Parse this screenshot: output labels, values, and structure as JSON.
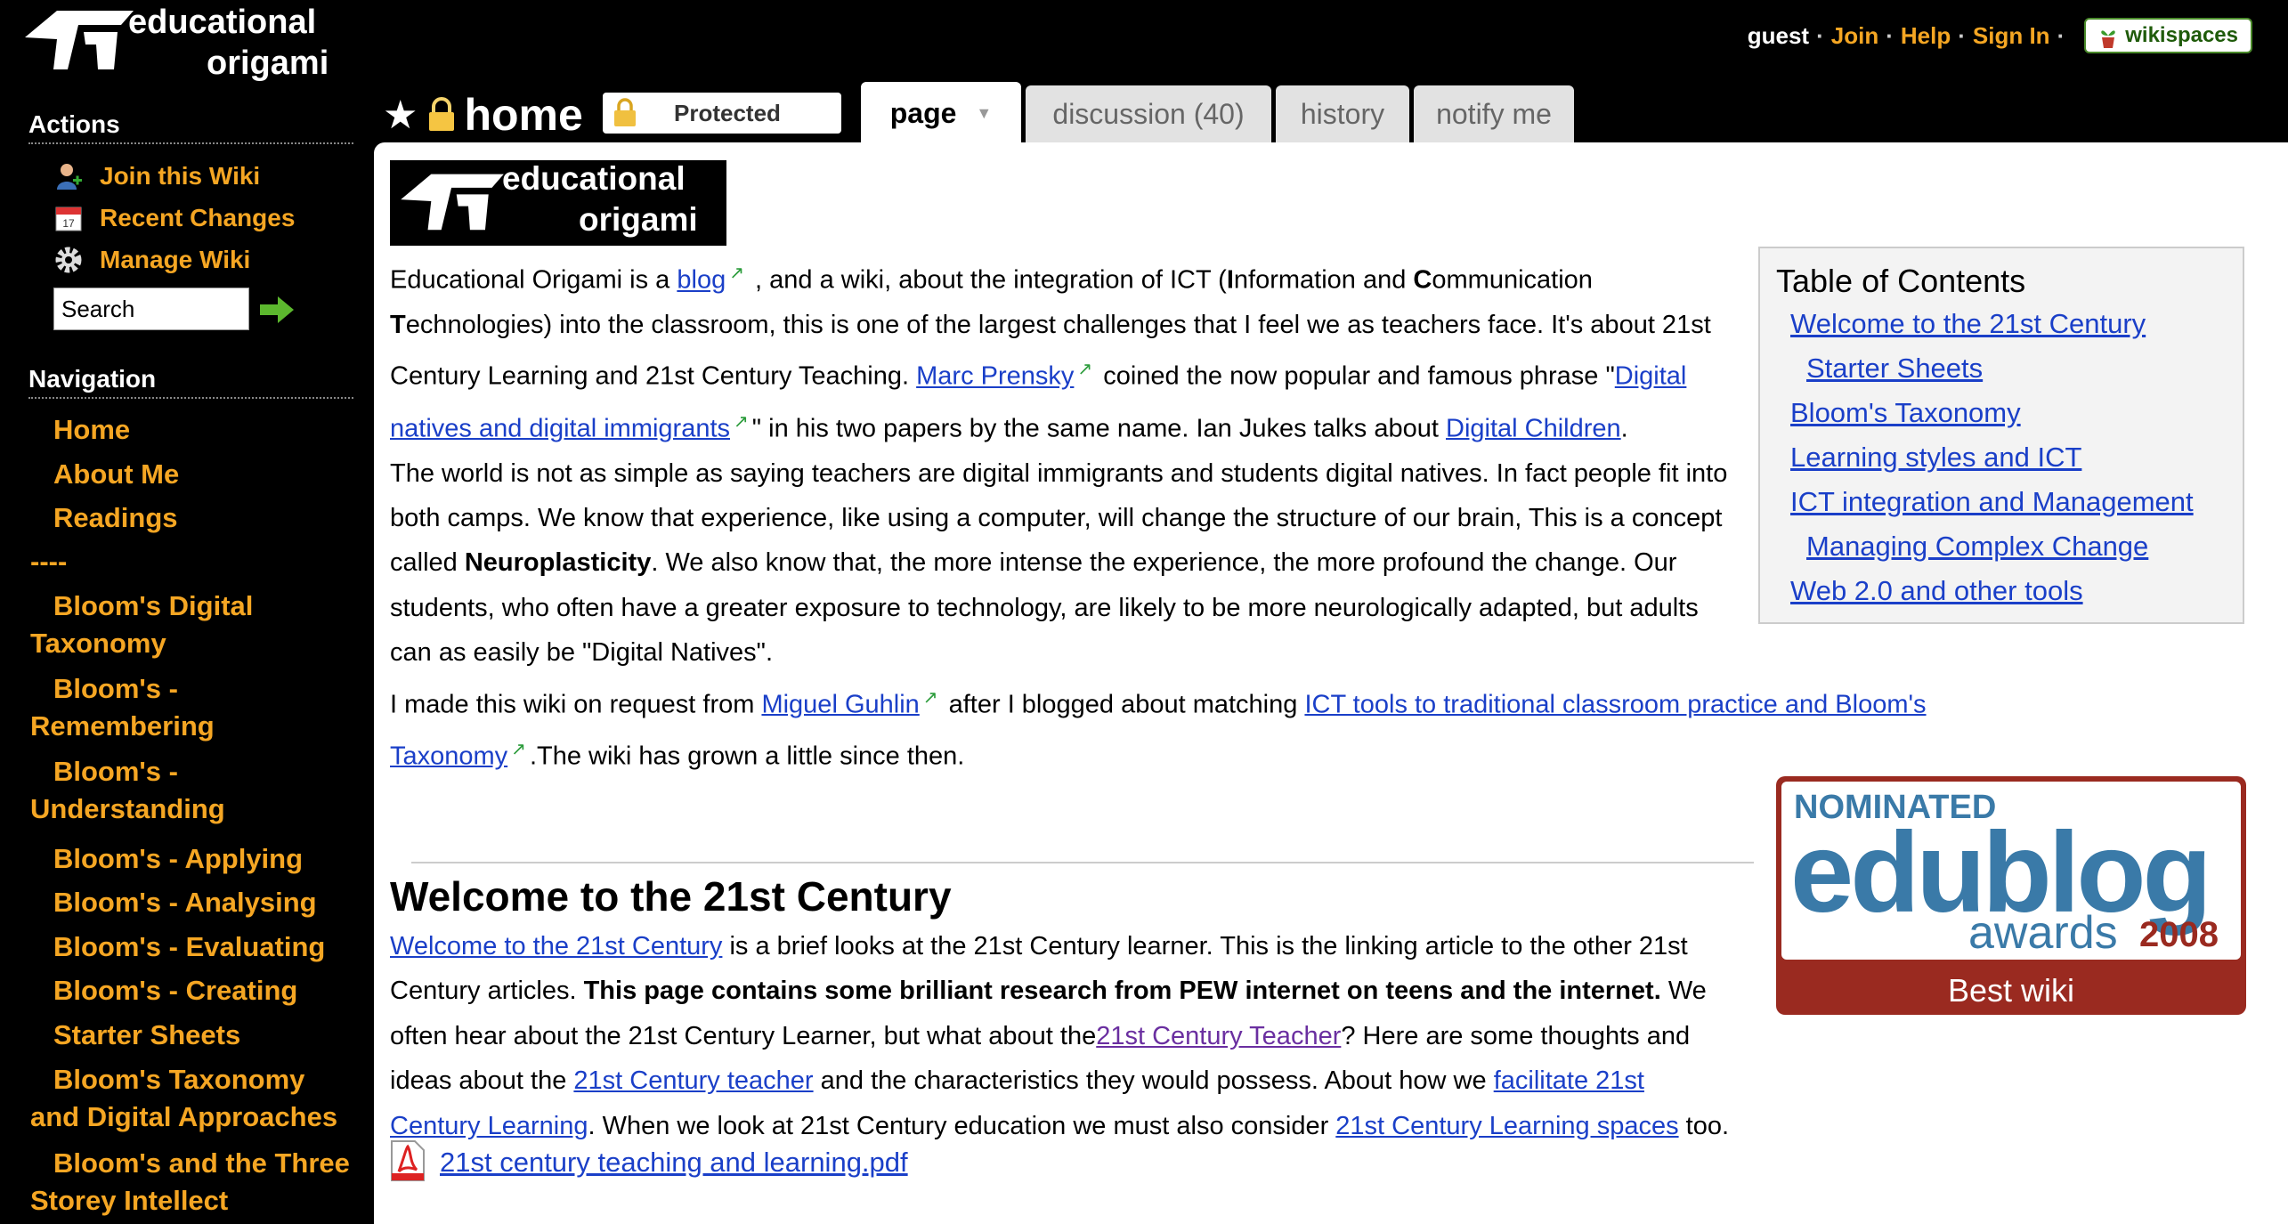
{
  "logo": {
    "line1": "educational",
    "line2": "origami"
  },
  "sidebar": {
    "actions_heading": "Actions",
    "actions": [
      {
        "label": "Join this Wiki",
        "icon": "user-add-icon"
      },
      {
        "label": "Recent Changes",
        "icon": "calendar-icon"
      },
      {
        "label": "Manage Wiki",
        "icon": "gear-icon"
      }
    ],
    "search_value": "Search",
    "navigation_heading": "Navigation",
    "nav": [
      "Home",
      "About Me",
      "Readings",
      "----",
      "Bloom's Digital Taxonomy",
      "Bloom's - Remembering",
      "Bloom's - Understanding",
      "Bloom's - Applying",
      "Bloom's - Analysing",
      "Bloom's - Evaluating",
      "Bloom's - Creating",
      "Starter Sheets",
      "Bloom's Taxonomy and Digital Approaches",
      "Bloom's and the Three Storey Intellect"
    ]
  },
  "userbar": {
    "guest": "guest",
    "join": "Join",
    "help": "Help",
    "signin": "Sign In",
    "brand": "wikispaces"
  },
  "page": {
    "title": "home",
    "protected_label": "Protected",
    "tabs": {
      "page": "page",
      "discussion": "discussion (40)",
      "history": "history",
      "notify": "notify me"
    }
  },
  "content": {
    "p1": {
      "a": "Educational Origami is a ",
      "blog_link": "blog",
      "b": " , and a wiki, about the integration of ICT (",
      "I": "I",
      "c": "nformation and ",
      "C": "C",
      "d": "ommunication ",
      "T": "T",
      "e": "echnologies) into the classroom, this is one of the largest challenges that I feel we as teachers face. It's about 21st Century Learning and 21st Century Teaching. ",
      "prensky_link": "Marc Prensky",
      "f": " coined the now popular and famous phrase \"",
      "natives_link": "Digital natives and digital immigrants",
      "g": "\" in his two papers by the same name. Ian Jukes talks about ",
      "children_link": "Digital Children",
      "h": "."
    },
    "p2": {
      "a": "The world is not as simple as saying teachers are digital immigrants and students digital natives. In fact people fit into both camps. We know that experience, like using a computer, will change the structure of our brain, This is a concept called ",
      "bold": "Neuroplasticity",
      "b": ". We also know that, the more intense the experience, the more profound the change. Our students, who often have a greater exposure to technology, are likely to be more neurologically adapted, but adults can as easily be \"Digital Natives\"."
    },
    "p3": {
      "a": "I made this wiki on request from ",
      "guhlin_link": "Miguel Guhlin",
      "b": " after I blogged about matching ",
      "ict_link": "ICT tools to traditional classroom practice and Bloom's Taxonomy",
      "c": ".The wiki has grown a little since then."
    },
    "toc": {
      "title": "Table of Contents",
      "items": [
        {
          "label": "Welcome to the 21st Century",
          "level": 1
        },
        {
          "label": "Starter Sheets",
          "level": 2
        },
        {
          "label": "Bloom's Taxonomy",
          "level": 1
        },
        {
          "label": "Learning styles and ICT",
          "level": 1
        },
        {
          "label": "ICT integration and Management",
          "level": 1
        },
        {
          "label": "Managing Complex Change",
          "level": 2
        },
        {
          "label": "Web 2.0 and other tools",
          "level": 1
        }
      ]
    },
    "award": {
      "nominated": "NOMINATED",
      "edublog": "edublog",
      "awards": "awards",
      "year": "2008",
      "best": "Best wiki"
    },
    "welcome": {
      "heading": "Welcome to the 21st Century",
      "link1": "Welcome to the 21st Century",
      "a": " is a brief looks at the 21st Century learner. This is the linking article to the other 21st Century articles. ",
      "bold": "This page contains some brilliant research from PEW internet on teens and the internet.",
      "b": " We often hear about the 21st Century Learner, but what about the",
      "link2": "21st Century Teacher",
      "c": "? Here are some thoughts and ideas about the ",
      "link3": "21st Century teacher",
      "d": " and the characteristics they would possess. About how we ",
      "link4": "facilitate 21st Century Learning",
      "e": ". When we look at 21st Century education we must also consider ",
      "link5": "21st Century Learning spaces",
      "f": " too."
    },
    "pdf": {
      "filename": "21st century teaching and learning.pdf",
      "icon": "pdf-icon"
    }
  }
}
